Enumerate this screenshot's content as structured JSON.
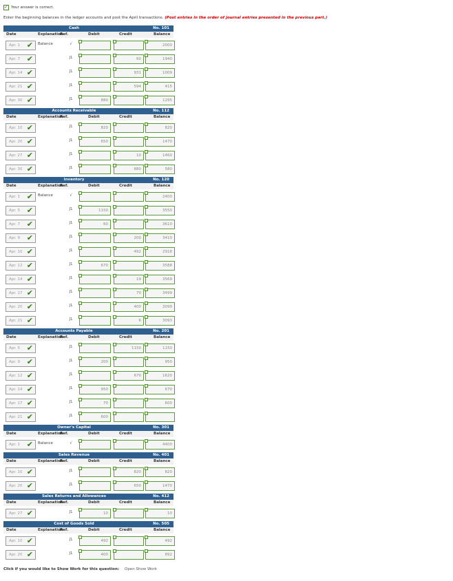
{
  "status": "Your answer is correct.",
  "instruction": "Enter the beginning balances in the ledger accounts and post the April transactions.",
  "instruction_note": "(Post entries in the order of journal entries presented in the previous part.)",
  "columns": {
    "date": "Date",
    "explanation": "Explanation",
    "ref": "Ref.",
    "debit": "Debit",
    "credit": "Credit",
    "balance": "Balance"
  },
  "ledgers": [
    {
      "title": "Cash",
      "number": "No. 101",
      "rows": [
        {
          "date": "Apr. 1",
          "expl": "Balance",
          "ref": "√",
          "debit": "",
          "credit": "",
          "balance": "2000"
        },
        {
          "date": "Apr. 7",
          "expl": "",
          "ref": "J1",
          "debit": "",
          "credit": "60",
          "balance": "1940"
        },
        {
          "date": "Apr. 14",
          "expl": "",
          "ref": "J1",
          "debit": "",
          "credit": "931",
          "balance": "1009"
        },
        {
          "date": "Apr. 21",
          "expl": "",
          "ref": "J1",
          "debit": "",
          "credit": "594",
          "balance": "415"
        },
        {
          "date": "Apr. 30",
          "expl": "",
          "ref": "J1",
          "debit": "880",
          "credit": "",
          "balance": "1295"
        }
      ]
    },
    {
      "title": "Accounts Receivable",
      "number": "No. 112",
      "rows": [
        {
          "date": "Apr. 10",
          "expl": "",
          "ref": "J1",
          "debit": "820",
          "credit": "",
          "balance": "820"
        },
        {
          "date": "Apr. 20",
          "expl": "",
          "ref": "J1",
          "debit": "650",
          "credit": "",
          "balance": "1470"
        },
        {
          "date": "Apr. 27",
          "expl": "",
          "ref": "J1",
          "debit": "",
          "credit": "10",
          "balance": "1460"
        },
        {
          "date": "Apr. 30",
          "expl": "",
          "ref": "J1",
          "debit": "",
          "credit": "880",
          "balance": "580"
        }
      ]
    },
    {
      "title": "Inventory",
      "number": "No. 120",
      "rows": [
        {
          "date": "Apr. 1",
          "expl": "Balance",
          "ref": "√",
          "debit": "",
          "credit": "",
          "balance": "2400"
        },
        {
          "date": "Apr. 5",
          "expl": "",
          "ref": "J1",
          "debit": "1150",
          "credit": "",
          "balance": "3550"
        },
        {
          "date": "Apr. 7",
          "expl": "",
          "ref": "J1",
          "debit": "60",
          "credit": "",
          "balance": "3610"
        },
        {
          "date": "Apr. 9",
          "expl": "",
          "ref": "J1",
          "debit": "",
          "credit": "200",
          "balance": "3410"
        },
        {
          "date": "Apr. 10",
          "expl": "",
          "ref": "J1",
          "debit": "",
          "credit": "492",
          "balance": "2918"
        },
        {
          "date": "Apr. 12",
          "expl": "",
          "ref": "J1",
          "debit": "670",
          "credit": "",
          "balance": "3588"
        },
        {
          "date": "Apr. 14",
          "expl": "",
          "ref": "J1",
          "debit": "",
          "credit": "19",
          "balance": "3569"
        },
        {
          "date": "Apr. 17",
          "expl": "",
          "ref": "J1",
          "debit": "",
          "credit": "70",
          "balance": "3499"
        },
        {
          "date": "Apr. 20",
          "expl": "",
          "ref": "J1",
          "debit": "",
          "credit": "400",
          "balance": "3099"
        },
        {
          "date": "Apr. 21",
          "expl": "",
          "ref": "J1",
          "debit": "",
          "credit": "6",
          "balance": "3093"
        }
      ]
    },
    {
      "title": "Accounts Payable",
      "number": "No. 201",
      "rows": [
        {
          "date": "Apr. 5",
          "expl": "",
          "ref": "J1",
          "debit": "",
          "credit": "1150",
          "balance": "1150"
        },
        {
          "date": "Apr. 9",
          "expl": "",
          "ref": "J1",
          "debit": "200",
          "credit": "",
          "balance": "950"
        },
        {
          "date": "Apr. 12",
          "expl": "",
          "ref": "J1",
          "debit": "",
          "credit": "670",
          "balance": "1620"
        },
        {
          "date": "Apr. 14",
          "expl": "",
          "ref": "J1",
          "debit": "950",
          "credit": "",
          "balance": "670"
        },
        {
          "date": "Apr. 17",
          "expl": "",
          "ref": "J1",
          "debit": "70",
          "credit": "",
          "balance": "600"
        },
        {
          "date": "Apr. 21",
          "expl": "",
          "ref": "J1",
          "debit": "600",
          "credit": "",
          "balance": ""
        }
      ]
    },
    {
      "title": "Owner's Capital",
      "number": "No. 301",
      "rows": [
        {
          "date": "Apr. 1",
          "expl": "Balance",
          "ref": "√",
          "debit": "",
          "credit": "",
          "balance": "4400"
        }
      ]
    },
    {
      "title": "Sales Revenue",
      "number": "No. 401",
      "rows": [
        {
          "date": "Apr. 10",
          "expl": "",
          "ref": "J1",
          "debit": "",
          "credit": "820",
          "balance": "820"
        },
        {
          "date": "Apr. 20",
          "expl": "",
          "ref": "J1",
          "debit": "",
          "credit": "650",
          "balance": "1470"
        }
      ]
    },
    {
      "title": "Sales Returns and Allowances",
      "number": "No. 412",
      "rows": [
        {
          "date": "Apr. 27",
          "expl": "",
          "ref": "J1",
          "debit": "10",
          "credit": "",
          "balance": "10"
        }
      ]
    },
    {
      "title": "Cost of Goods Sold",
      "number": "No. 505",
      "rows": [
        {
          "date": "Apr. 10",
          "expl": "",
          "ref": "J1",
          "debit": "492",
          "credit": "",
          "balance": "492"
        },
        {
          "date": "Apr. 20",
          "expl": "",
          "ref": "J1",
          "debit": "400",
          "credit": "",
          "balance": "892"
        }
      ]
    }
  ],
  "footer": {
    "prompt": "Click if you would like to Show Work for this question:",
    "link": "Open Show Work"
  },
  "colors": {
    "header": "#2e5f8e",
    "correct": "#5a9a3a",
    "warn": "#cc0000"
  }
}
